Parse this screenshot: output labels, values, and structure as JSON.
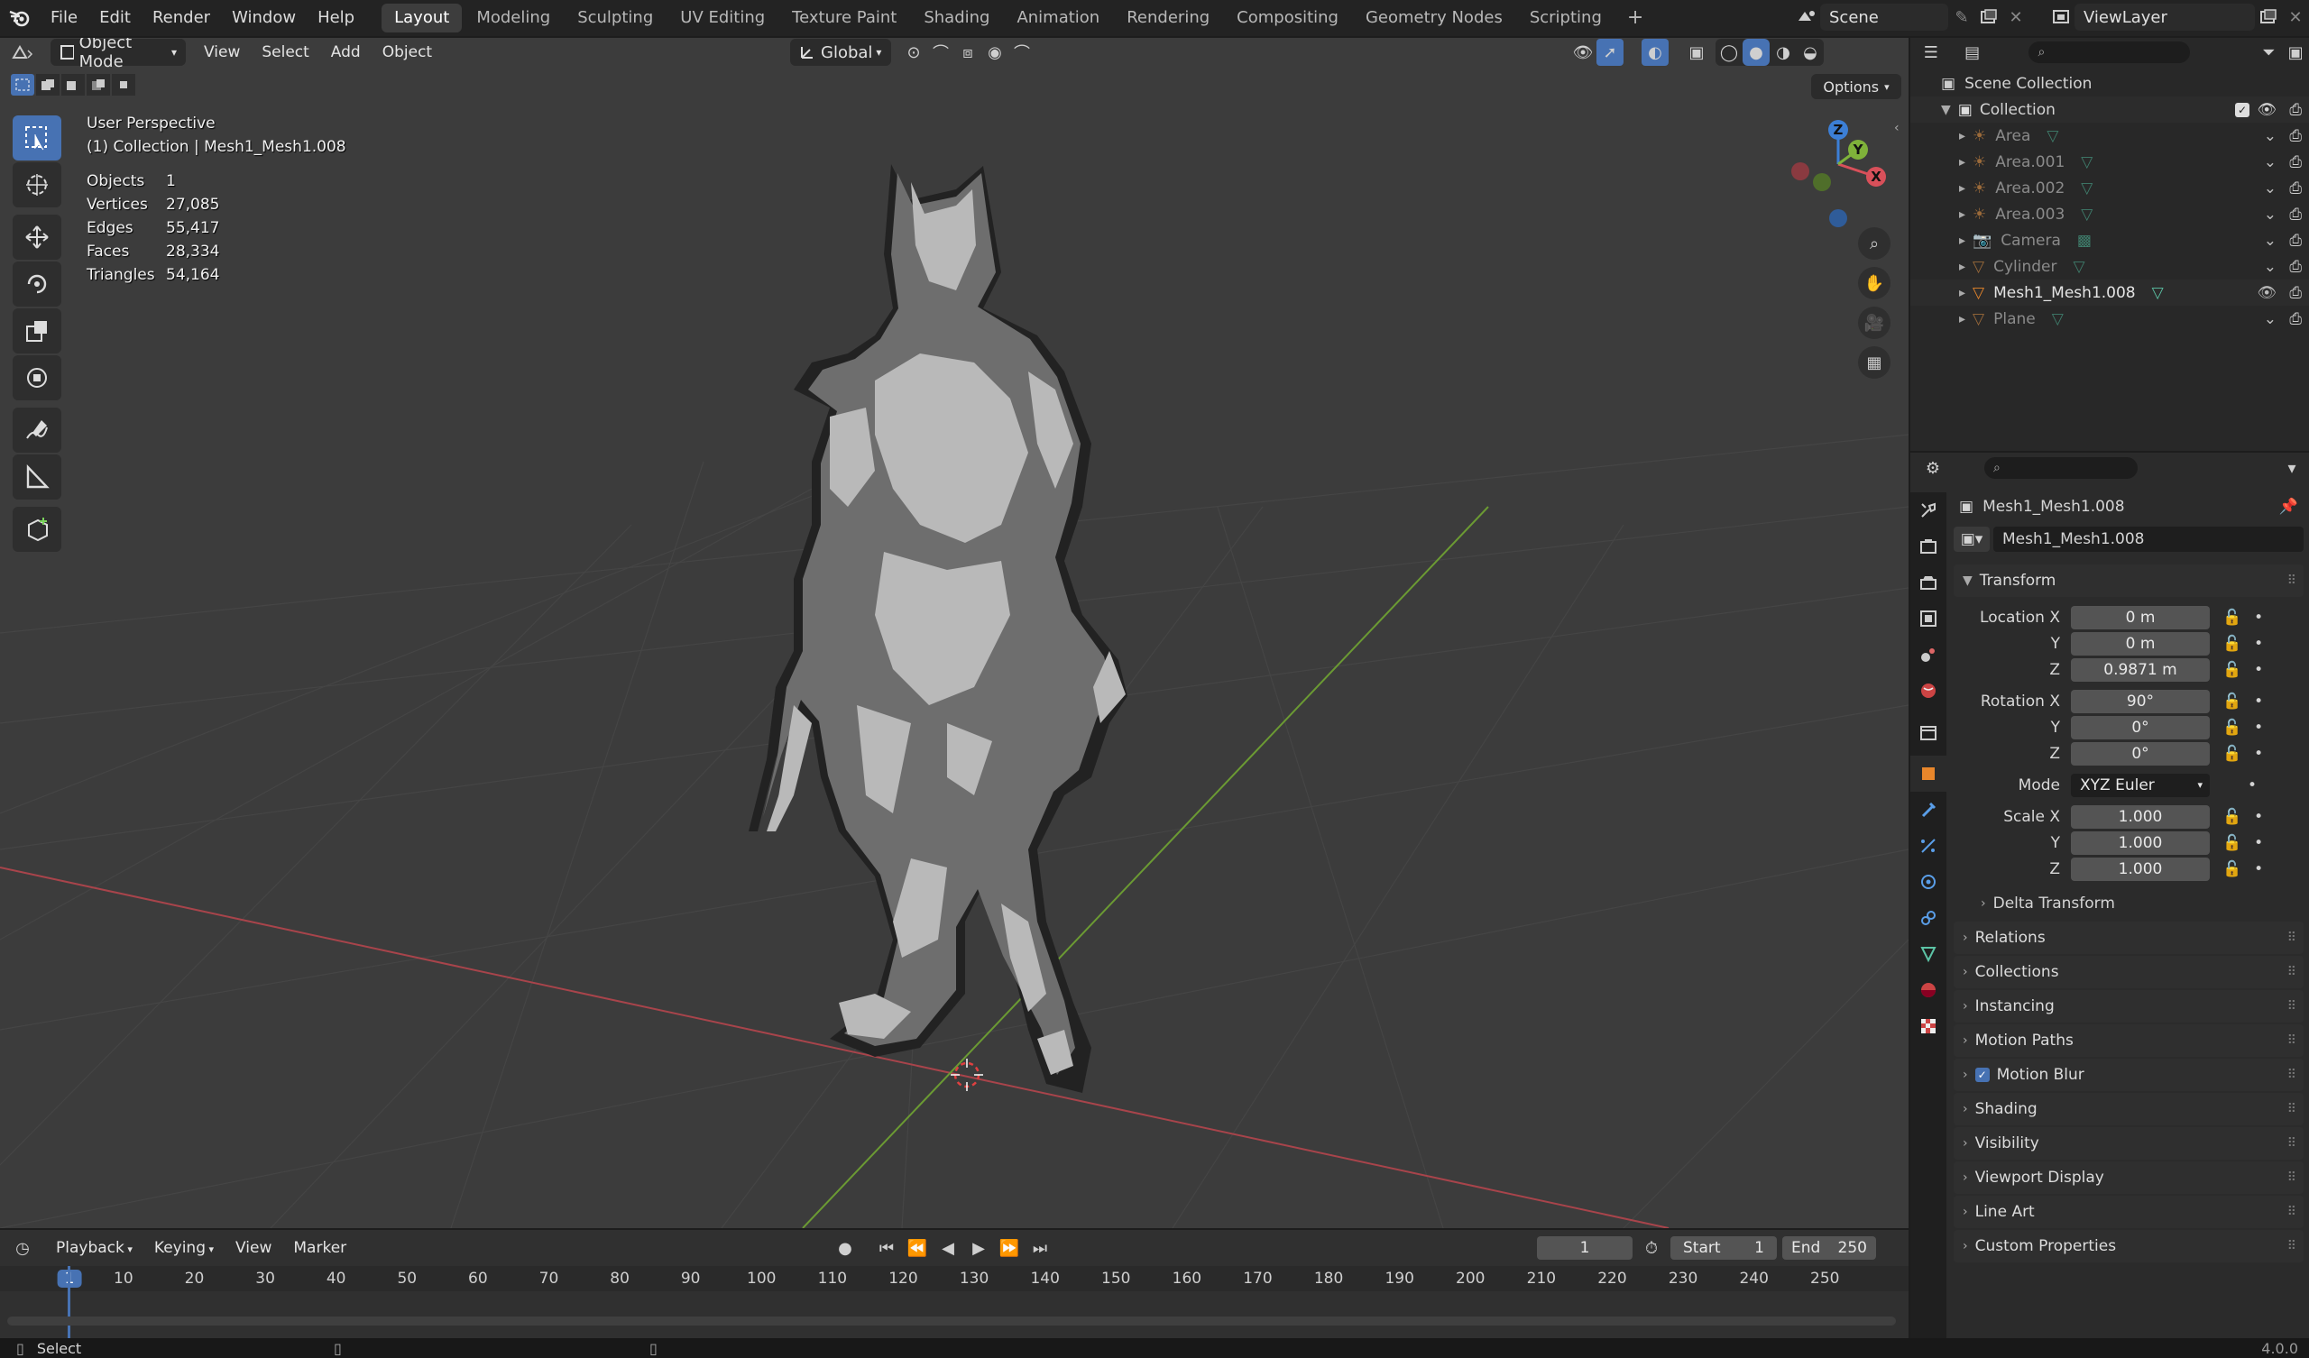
{
  "top_menu": [
    "File",
    "Edit",
    "Render",
    "Window",
    "Help"
  ],
  "workspaces": [
    "Layout",
    "Modeling",
    "Sculpting",
    "UV Editing",
    "Texture Paint",
    "Shading",
    "Animation",
    "Rendering",
    "Compositing",
    "Geometry Nodes",
    "Scripting"
  ],
  "active_workspace": "Layout",
  "add_workspace": "+",
  "scene": {
    "name": "Scene"
  },
  "view_layer": {
    "name": "ViewLayer"
  },
  "viewport": {
    "mode": "Object Mode",
    "menus": [
      "View",
      "Select",
      "Add",
      "Object"
    ],
    "orientation": "Global",
    "options_label": "Options",
    "info_title": "User Perspective",
    "info_collection": "(1) Collection | Mesh1_Mesh1.008",
    "stats": [
      {
        "label": "Objects",
        "value": "1"
      },
      {
        "label": "Vertices",
        "value": "27,085"
      },
      {
        "label": "Edges",
        "value": "55,417"
      },
      {
        "label": "Faces",
        "value": "28,334"
      },
      {
        "label": "Triangles",
        "value": "54,164"
      }
    ],
    "gizmo": {
      "z": "Z",
      "y": "Y",
      "x": "X"
    }
  },
  "outliner": {
    "root": "Scene Collection",
    "collection": "Collection",
    "items": [
      {
        "name": "Area",
        "type": "light",
        "visible": false
      },
      {
        "name": "Area.001",
        "type": "light",
        "visible": false
      },
      {
        "name": "Area.002",
        "type": "light",
        "visible": false
      },
      {
        "name": "Area.003",
        "type": "light",
        "visible": false
      },
      {
        "name": "Camera",
        "type": "camera",
        "visible": false
      },
      {
        "name": "Cylinder",
        "type": "mesh",
        "visible": false
      },
      {
        "name": "Mesh1_Mesh1.008",
        "type": "mesh",
        "visible": true
      },
      {
        "name": "Plane",
        "type": "mesh",
        "visible": false
      }
    ]
  },
  "properties": {
    "object_name": "Mesh1_Mesh1.008",
    "data_name": "Mesh1_Mesh1.008",
    "transform_label": "Transform",
    "location": {
      "label": "Location X",
      "x": "0 m",
      "y": "0 m",
      "z": "0.9871 m"
    },
    "rotation": {
      "label": "Rotation X",
      "x": "90°",
      "y": "0°",
      "z": "0°"
    },
    "mode": {
      "label": "Mode",
      "value": "XYZ Euler"
    },
    "scale": {
      "label": "Scale X",
      "x": "1.000",
      "y": "1.000",
      "z": "1.000"
    },
    "axis_y": "Y",
    "axis_z": "Z",
    "delta_transform": "Delta Transform",
    "panels": [
      "Relations",
      "Collections",
      "Instancing",
      "Motion Paths",
      "Motion Blur",
      "Shading",
      "Visibility",
      "Viewport Display",
      "Line Art",
      "Custom Properties"
    ]
  },
  "timeline": {
    "menus": [
      "Playback",
      "Keying",
      "View",
      "Marker"
    ],
    "current_frame": "1",
    "start_label": "Start",
    "start": "1",
    "end_label": "End",
    "end": "250",
    "ticks": [
      "1",
      "10",
      "20",
      "30",
      "40",
      "50",
      "60",
      "70",
      "80",
      "90",
      "100",
      "110",
      "120",
      "130",
      "140",
      "150",
      "160",
      "170",
      "180",
      "190",
      "200",
      "210",
      "220",
      "230",
      "240",
      "250"
    ]
  },
  "status": {
    "left": "Select",
    "version": "4.0.0"
  },
  "colors": {
    "accent": "#4772b3",
    "x_axis": "#d8505a",
    "y_axis": "#7fb23a",
    "z_axis": "#3c7fd6",
    "viewport_bg": "#3c3c3c",
    "highlight_green": "#5cc4a6"
  }
}
